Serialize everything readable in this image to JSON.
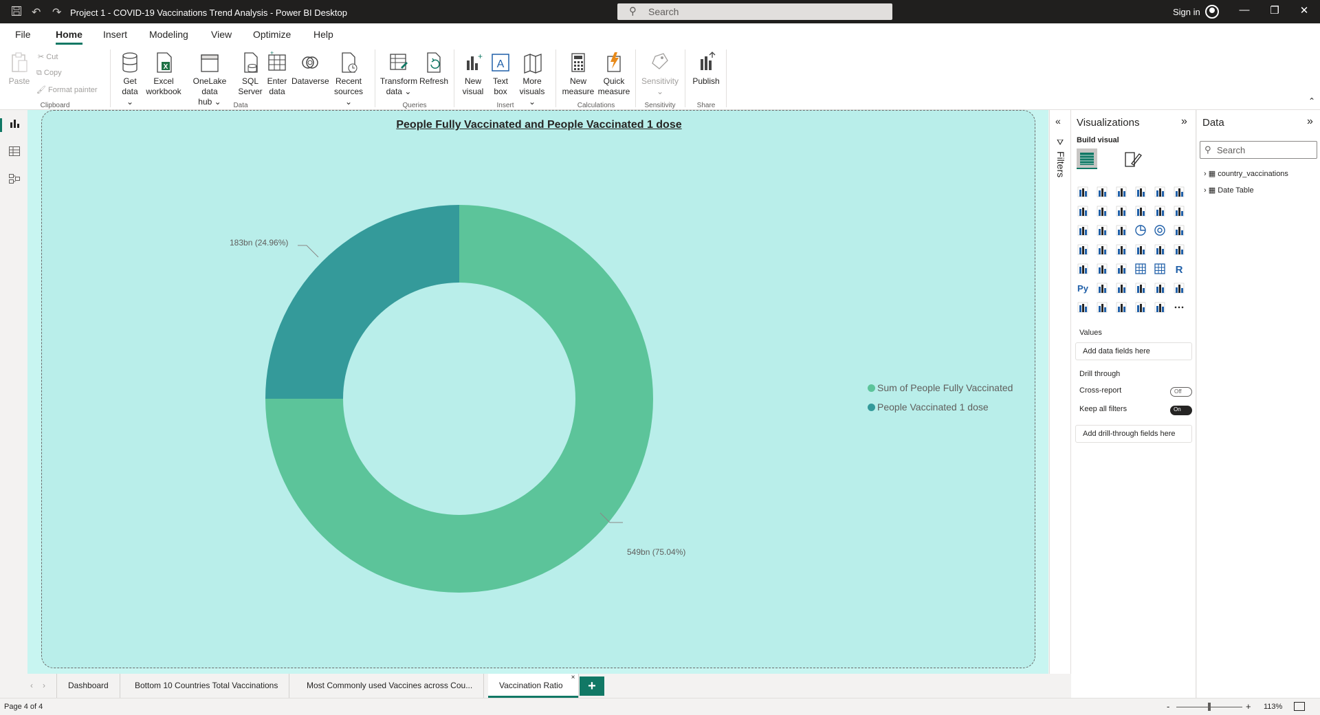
{
  "titlebar": {
    "title": "Project 1 - COVID-19 Vaccinations Trend Analysis - Power BI Desktop",
    "search_placeholder": "Search",
    "signin": "Sign in"
  },
  "menu": {
    "tabs": [
      "File",
      "Home",
      "Insert",
      "Modeling",
      "View",
      "Optimize",
      "Help"
    ],
    "active": "Home"
  },
  "ribbon": {
    "clipboard": {
      "paste": "Paste",
      "cut": "Cut",
      "copy": "Copy",
      "format_painter": "Format painter",
      "group": "Clipboard"
    },
    "data": {
      "get_data": [
        "Get",
        "data"
      ],
      "excel": [
        "Excel",
        "workbook"
      ],
      "onelake": [
        "OneLake data",
        "hub"
      ],
      "sql": [
        "SQL",
        "Server"
      ],
      "enter": [
        "Enter",
        "data"
      ],
      "dataverse": "Dataverse",
      "recent": [
        "Recent",
        "sources"
      ],
      "group": "Data"
    },
    "queries": {
      "transform": [
        "Transform",
        "data"
      ],
      "refresh": "Refresh",
      "group": "Queries"
    },
    "insert": {
      "new_visual": [
        "New",
        "visual"
      ],
      "text_box": [
        "Text",
        "box"
      ],
      "more_visuals": [
        "More",
        "visuals"
      ],
      "group": "Insert"
    },
    "calculations": {
      "new_measure": [
        "New",
        "measure"
      ],
      "quick_measure": [
        "Quick",
        "measure"
      ],
      "group": "Calculations"
    },
    "sensitivity": {
      "label": "Sensitivity",
      "group": "Sensitivity"
    },
    "share": {
      "publish": "Publish",
      "group": "Share"
    }
  },
  "visual": {
    "chart_data": {
      "type": "donut",
      "title": "People Fully Vaccinated and People Vaccinated 1 dose",
      "series": [
        {
          "name": "Sum of People Fully Vaccinated",
          "value": 549,
          "label": "549bn (75.04%)",
          "percent": 75.04,
          "color": "#5cc49a"
        },
        {
          "name": "People Vaccinated 1 dose",
          "value": 183,
          "label": "183bn (24.96%)",
          "percent": 24.96,
          "color": "#349a9a"
        }
      ],
      "legend_position": "right"
    }
  },
  "filters": {
    "label": "Filters"
  },
  "visualizations": {
    "header": "Visualizations",
    "build_visual": "Build visual",
    "values_label": "Values",
    "values_placeholder": "Add data fields here",
    "drill_through": "Drill through",
    "cross_report": "Cross-report",
    "cross_report_state": "Off",
    "keep_filters": "Keep all filters",
    "keep_filters_state": "On",
    "drill_placeholder": "Add drill-through fields here"
  },
  "datapane": {
    "header": "Data",
    "search_placeholder": "Search",
    "tables": [
      "country_vaccinations",
      "Date Table"
    ]
  },
  "pages": {
    "tabs": [
      "Dashboard",
      "Bottom 10 Countries Total Vaccinations",
      "Most Commonly used Vaccines across Cou...",
      "Vaccination Ratio"
    ],
    "active": "Vaccination Ratio",
    "add": "+"
  },
  "status": {
    "page": "Page 4 of 4",
    "zoom": "113%"
  },
  "colors": {
    "accent": "#117865",
    "canvas": "#b9eeea"
  }
}
